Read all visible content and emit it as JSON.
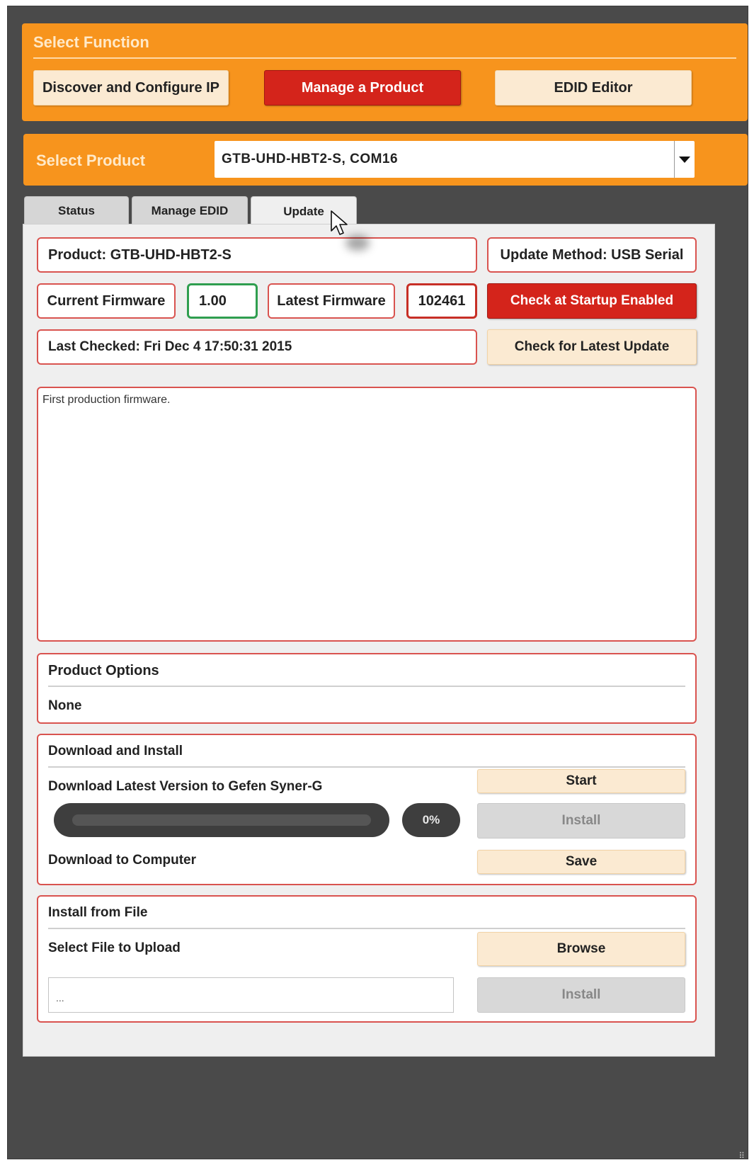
{
  "select_function": {
    "title": "Select Function",
    "buttons": {
      "discover": "Discover and Configure IP",
      "manage": "Manage a Product",
      "edid": "EDID Editor"
    }
  },
  "select_product": {
    "title": "Select Product",
    "selected": "GTB-UHD-HBT2-S, COM16"
  },
  "tabs": {
    "status": "Status",
    "manage_edid": "Manage EDID",
    "update": "Update"
  },
  "update": {
    "product": "Product: GTB-UHD-HBT2-S",
    "update_method": "Update Method: USB Serial",
    "current_firmware_label": "Current Firmware",
    "current_firmware_value": "1.00",
    "latest_firmware_label": "Latest Firmware",
    "latest_firmware_value": "102461",
    "check_startup_button": "Check at Startup Enabled",
    "last_checked": "Last Checked: Fri Dec 4 17:50:31 2015",
    "check_latest_button": "Check for Latest Update",
    "release_notes": "First production firmware."
  },
  "product_options": {
    "title": "Product Options",
    "value": "None"
  },
  "download_install": {
    "title": "Download and Install",
    "download_latest_label": "Download Latest Version to Gefen Syner-G",
    "start_button": "Start",
    "progress": 0,
    "progress_text": "0%",
    "install_button": "Install",
    "download_computer_label": "Download to Computer",
    "save_button": "Save"
  },
  "install_file": {
    "title": "Install from File",
    "select_label": "Select File to Upload",
    "browse_button": "Browse",
    "file_value": "...",
    "install_button": "Install"
  },
  "colors": {
    "accent_orange": "#f7941d",
    "active_red": "#d4241b",
    "box_border_red": "#d9534f",
    "firmware_green": "#2f9e4f"
  }
}
